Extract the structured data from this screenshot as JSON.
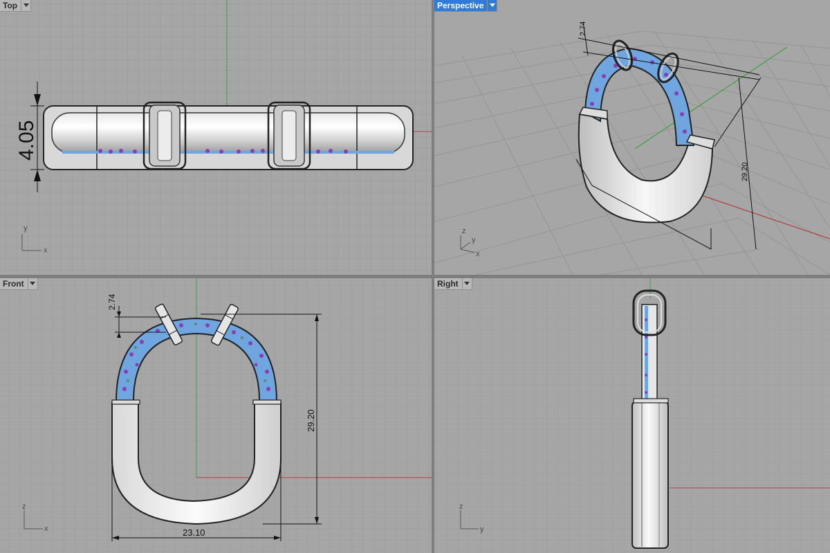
{
  "viewports": {
    "top": {
      "label": "Top"
    },
    "perspective": {
      "label": "Perspective"
    },
    "front": {
      "label": "Front"
    },
    "right": {
      "label": "Right"
    }
  },
  "dimensions": {
    "top_height": "4.05",
    "perspective_bail": "2.74",
    "perspective_height": "29.20",
    "front_bail": "2.74",
    "front_height": "29.20",
    "front_width": "23.10"
  },
  "axes": {
    "top": [
      "y",
      "x"
    ],
    "perspective": [
      "z",
      "y",
      "x"
    ],
    "front": [
      "z",
      "x"
    ],
    "right": [
      "z",
      "y"
    ]
  },
  "colors": {
    "viewport_bg": "#a6a6a6",
    "grid_minor": "#9a9a9a",
    "grid_major": "#8a8a8a",
    "axis_x": "#b04040",
    "axis_y": "#3fa03f",
    "active_tab": "#2f7bd9",
    "gem_blue": "#6fa6e0",
    "gem_purple": "#8a3fb0"
  },
  "icons": {
    "tab_menu": "chevron-down-icon"
  }
}
